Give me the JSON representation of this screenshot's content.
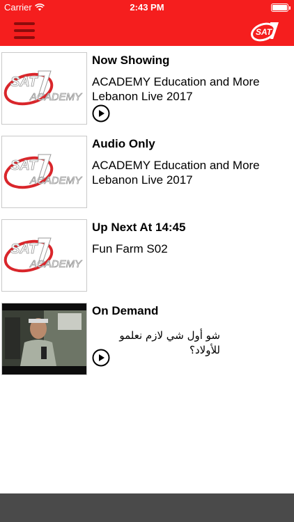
{
  "status_bar": {
    "carrier": "Carrier",
    "time": "2:43 PM",
    "battery_level": 1.0
  },
  "header": {
    "menu_icon": "hamburger-menu-icon",
    "logo_icon": "sat7-logo-icon",
    "logo_text": "SAT7"
  },
  "thumbnail_logo": {
    "text": "SAT7 ACADEMY"
  },
  "rows": [
    {
      "title": "Now Showing",
      "line1": "ACADEMY Education and More",
      "line2": "Lebanon Live 2017",
      "has_play": true
    },
    {
      "title": "Audio Only",
      "line1": "ACADEMY Education and More",
      "line2": "Lebanon Live 2017",
      "has_play": false
    },
    {
      "title": "Up Next At 14:45",
      "line1": "Fun Farm S02",
      "has_play": false
    },
    {
      "title": "On Demand",
      "line1": "شو أول شي لازم نعلمو للأولاد؟",
      "has_play": true
    }
  ],
  "colors": {
    "brand_red": "#f51e1e",
    "menu_dark_red": "#8c0c0c",
    "footer_gray": "#4a4a4a"
  }
}
